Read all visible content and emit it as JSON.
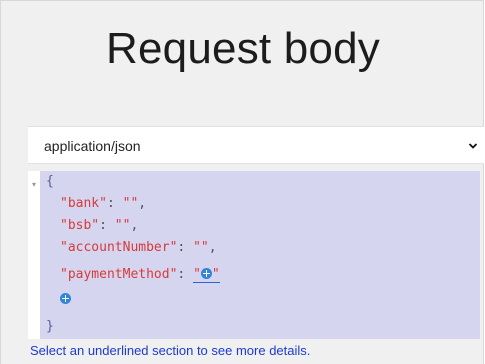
{
  "section": {
    "title": "Request body"
  },
  "content_type": {
    "selected": "application/json"
  },
  "editor": {
    "open_brace": "{",
    "close_brace": "}",
    "fields": [
      {
        "key": "\"bank\"",
        "value": "\"\""
      },
      {
        "key": "\"bsb\"",
        "value": "\"\""
      },
      {
        "key": "\"accountNumber\"",
        "value": "\"\""
      },
      {
        "key": "\"paymentMethod\"",
        "value": "\""
      }
    ],
    "colon": ": ",
    "comma": ",",
    "quote": "\"",
    "add_icon": "plus-circle-icon"
  },
  "hint": {
    "text": "Select an underlined section to see more details."
  },
  "colors": {
    "key": "#d63a3a",
    "highlight": "#d6d5f0",
    "link": "#1a3bd1",
    "add_icon": "#2f86d6"
  }
}
